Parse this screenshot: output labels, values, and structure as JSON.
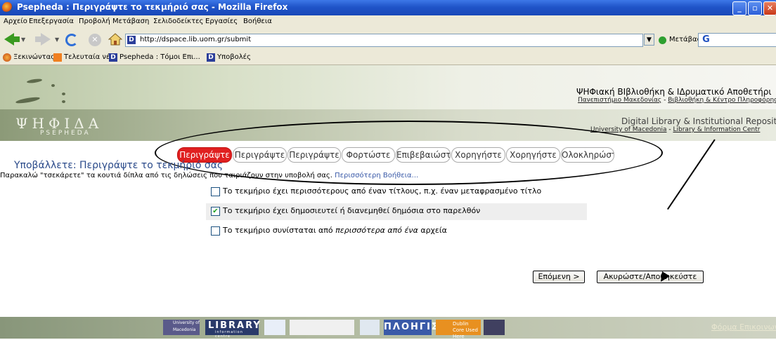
{
  "window": {
    "title": "Psepheda : Περιγράψτε το τεκμήριό σας - Mozilla Firefox"
  },
  "menu": [
    "Αρχείο",
    "Επεξεργασία",
    "Προβολή",
    "Μετάβαση",
    "Σελιδοδείκτες",
    "Εργασίες",
    "Βοήθεια"
  ],
  "nav": {
    "url": "http://dspace.lib.uom.gr/submit",
    "go_label": "Μετάβαση"
  },
  "bookmarks": [
    "Ξεκινώντας",
    "Τελευταία νέα",
    "Psepheda : Τόμοι Επι...",
    "Υποβολές"
  ],
  "header": {
    "logo": "ΨΗΦΙΔΑ",
    "logo_sub": "PSEPHEDA",
    "gr_title": "ΨΗΦιακή ΒΙβλιοθήκη & ΙΔρυματικό Αποθετήρι",
    "gr_link1": "Πανεπιστήμιο Μακεδονίας",
    "gr_link2": "Βιβλιοθήκη & Κέντρο Πληροφόρηση",
    "en_title": "Digital Library & Institutional Repositor",
    "en_link1": "University of Macedonia",
    "en_link2": "Library & Information Centr",
    "dash": " - "
  },
  "steps": [
    "Περιγράψτε",
    "Περιγράψτε",
    "Περιγράψτε",
    "Φορτώστε",
    "Επιβεβαιώστε",
    "Χορηγήστε",
    "Χορηγήστε",
    "Ολοκληρώστε"
  ],
  "page": {
    "title": "Υποβάλλετε: Περιγράψτε το τεκμήριό σας",
    "instructions": "Παρακαλώ \"τσεκάρετε\" τα κουτιά δίπλα από τις δηλώσεις που ταιριάζουν στην υποβολή σας.",
    "help_link": "Περισσότερη Βοήθεια..."
  },
  "checkboxes": [
    {
      "label": "Το τεκμήριο έχει περισσότερους από έναν τίτλους, π.χ. έναν μεταφρασμένο τίτλο",
      "checked": false
    },
    {
      "label": "Το τεκμήριο έχει δημοσιευτεί ή διανεμηθεί δημόσια στο παρελθόν",
      "checked": true
    },
    {
      "label_pre": "Το τεκμήριο συνίσταται από ",
      "label_em": "περισσότερα από ένα",
      "label_post": " αρχεία",
      "checked": false
    }
  ],
  "buttons": {
    "next": "Επόμενη >",
    "cancel": "Ακυρώστε/Αποθηκεύστε"
  },
  "footer": {
    "uom": "University of Macedonia",
    "library": "LIBRARY",
    "library_sub": "information centre",
    "plo": "ΠΛΟΗΓΙΣ",
    "dublin": "Dublin Core Used Here",
    "contact": "Φόρμα Επικοινωνίας"
  },
  "colors": {
    "active_step": "#e02020",
    "title_blue": "#2a4a8a"
  }
}
